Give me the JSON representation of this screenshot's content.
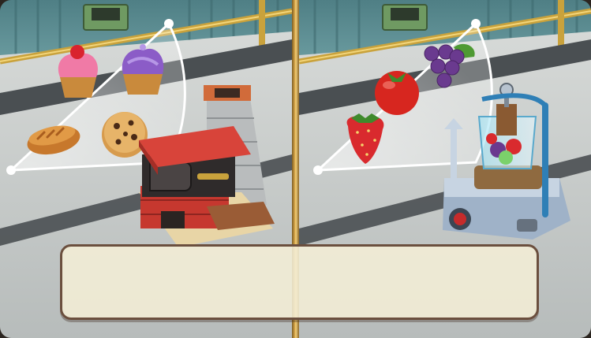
{
  "caption": {
    "text": ""
  },
  "left_machine": {
    "name": "bakery-oven",
    "products": [
      "pink-cupcake-icon",
      "purple-cupcake-icon",
      "bread-loaf-icon",
      "chocolate-chip-cookie-icon"
    ]
  },
  "right_machine": {
    "name": "juice-press",
    "products": [
      "grapes-icon",
      "tomato-icon",
      "strawberry-icon"
    ]
  },
  "colors": {
    "caption_bg": "#f4eed6",
    "caption_border": "#6b4f3e",
    "divider_gold": "#d9a84a",
    "wall_teal": "#5d8d92",
    "floor_grey": "#c9cdcc",
    "rail_brass": "#c9a23c"
  }
}
